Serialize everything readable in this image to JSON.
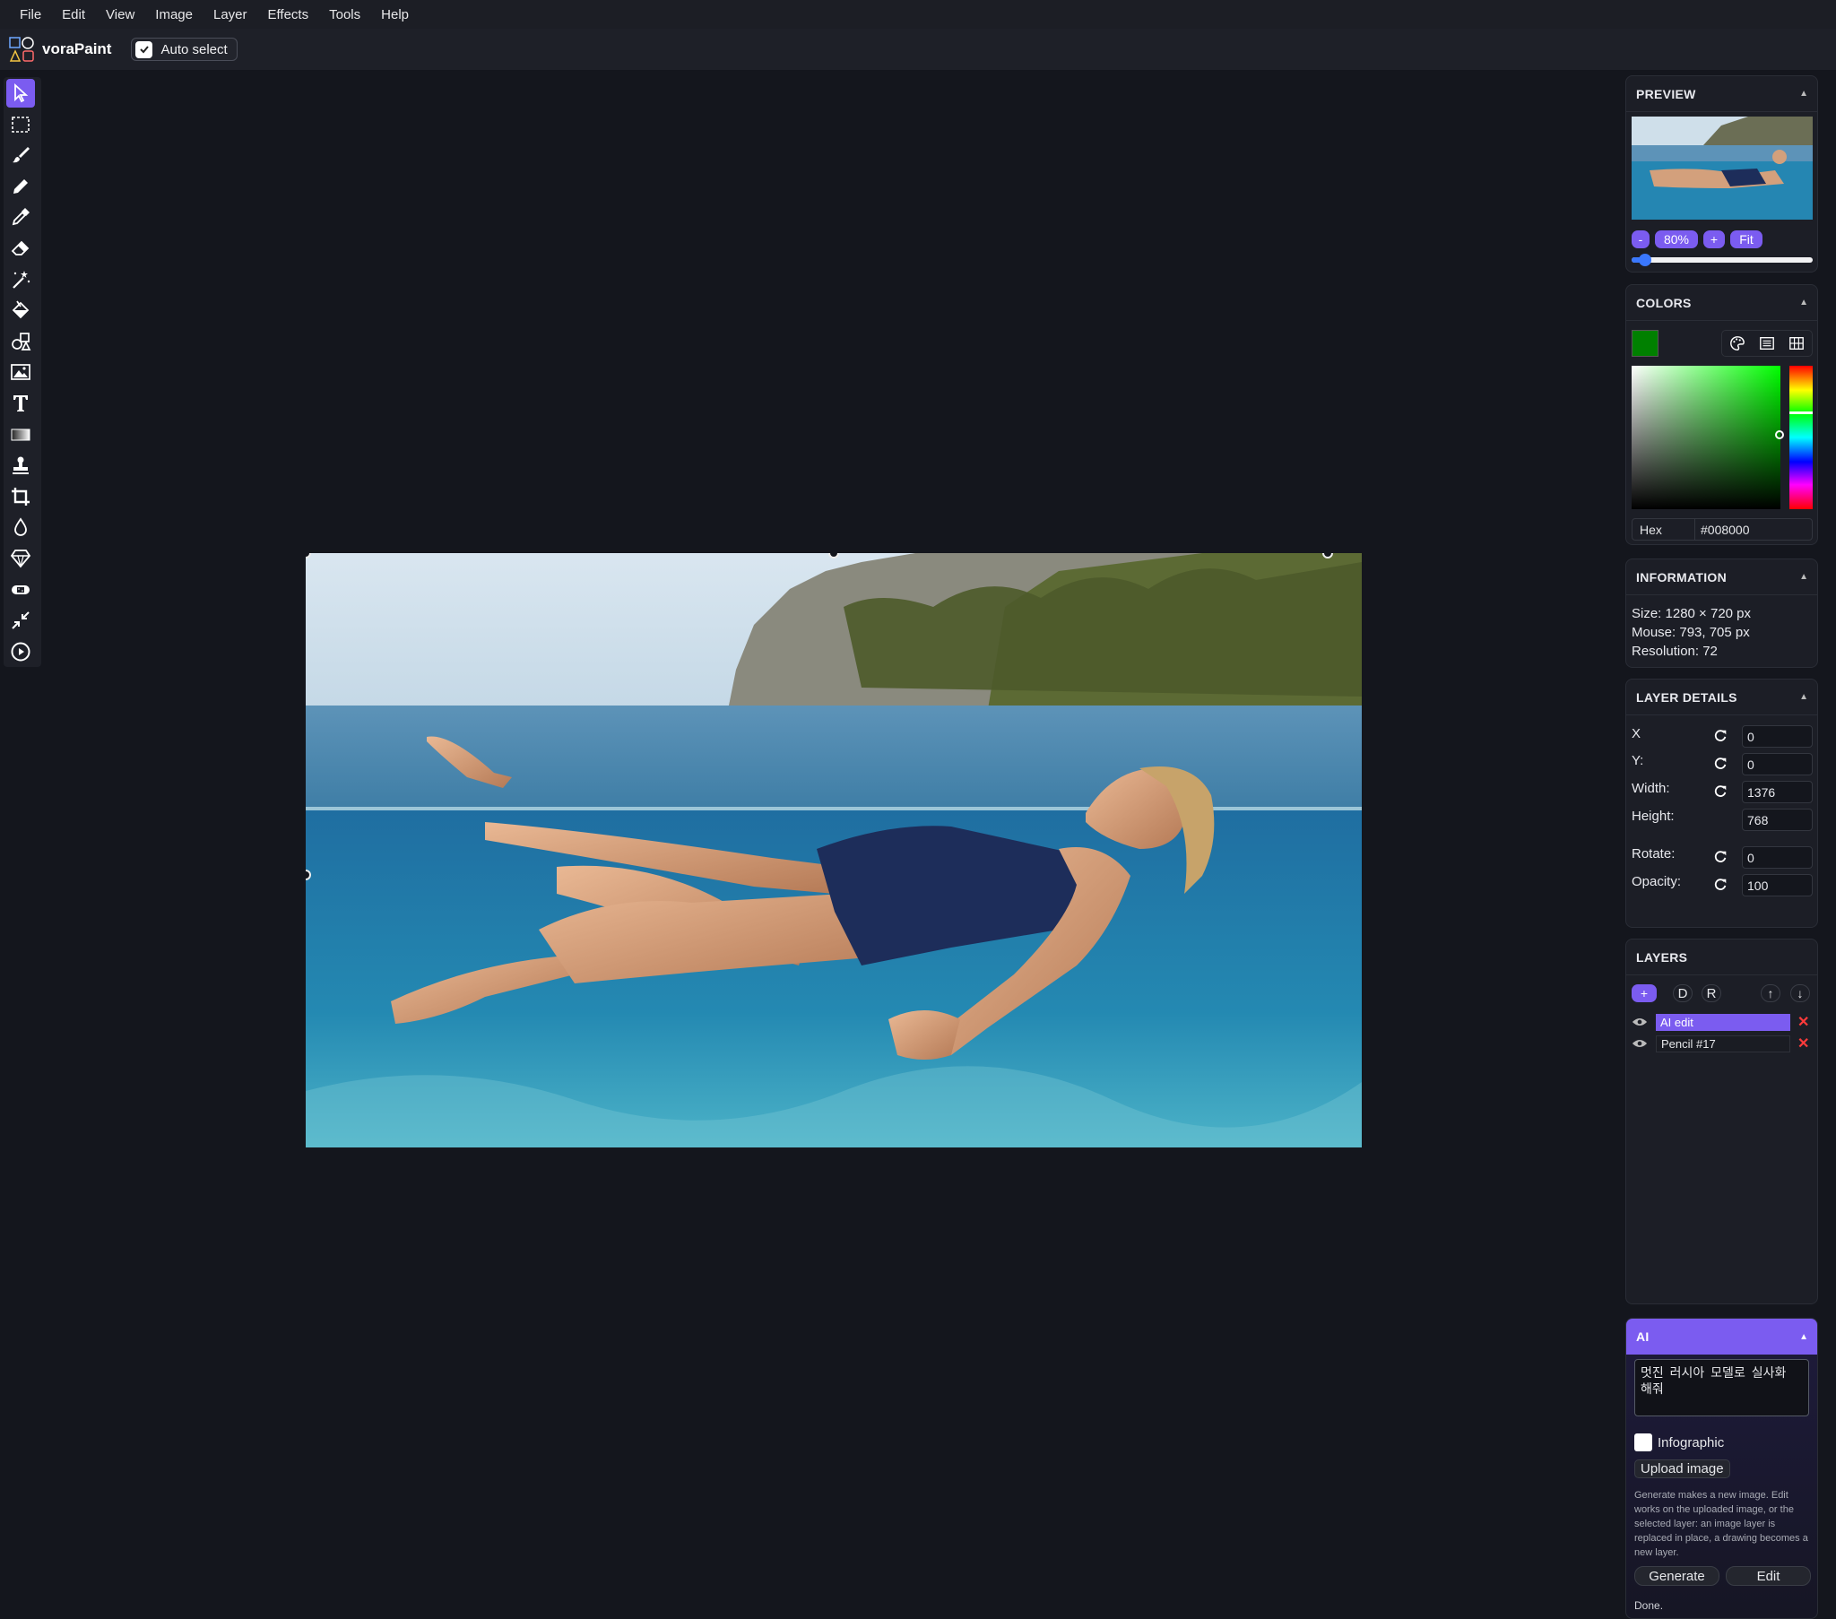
{
  "menu": [
    "File",
    "Edit",
    "View",
    "Image",
    "Layer",
    "Effects",
    "Tools",
    "Help"
  ],
  "toolbar": {
    "app_name": "voraPaint",
    "auto_select_label": "Auto select",
    "auto_select_checked": true
  },
  "tools": [
    "select-arrow-icon",
    "rect-select-icon",
    "brush-icon",
    "pencil-icon",
    "eyedropper-icon",
    "eraser-icon",
    "magic-wand-icon",
    "fill-bucket-icon",
    "shapes-icon",
    "image-icon",
    "text-icon",
    "gradient-icon",
    "stamp-icon",
    "crop-icon",
    "blur-drop-icon",
    "sharpen-icon",
    "bandage-icon",
    "resize-icon",
    "play-circle-icon"
  ],
  "preview": {
    "title": "PREVIEW",
    "zoom_minus": "-",
    "zoom_value": "80%",
    "zoom_plus": "+",
    "fit_label": "Fit",
    "zoom_slider_fraction": 0.08
  },
  "colors": {
    "title": "COLORS",
    "current": "#008000",
    "hex_label": "Hex",
    "hex_value": "#008000"
  },
  "information": {
    "title": "INFORMATION",
    "size": "Size: 1280 × 720 px",
    "mouse": "Mouse: 793, 705 px",
    "resolution": "Resolution: 72"
  },
  "layer_details": {
    "title": "LAYER DETAILS",
    "x_label": "X",
    "x_value": "0",
    "y_label": "Y:",
    "y_value": "0",
    "width_label": "Width:",
    "width_value": "1376",
    "height_label": "Height:",
    "height_value": "768",
    "rotate_label": "Rotate:",
    "rotate_value": "0",
    "opacity_label": "Opacity:",
    "opacity_value": "100"
  },
  "layers": {
    "title": "LAYERS",
    "add": "+",
    "dup": "D",
    "rename": "R",
    "up": "↑",
    "down": "↓",
    "items": [
      {
        "name": "AI edit",
        "selected": true
      },
      {
        "name": "Pencil #17",
        "selected": false
      }
    ]
  },
  "ai": {
    "title": "AI",
    "prompt": "멋진 러시아 모델로 실사화 해줘",
    "infographic_label": "Infographic",
    "upload_label": "Upload image",
    "help": "Generate makes a new image. Edit works on the uploaded image, or the selected layer: an image layer is replaced in place, a drawing becomes a new layer.",
    "generate_label": "Generate",
    "edit_label": "Edit",
    "status": "Done."
  },
  "accent": "#7b5cf0"
}
